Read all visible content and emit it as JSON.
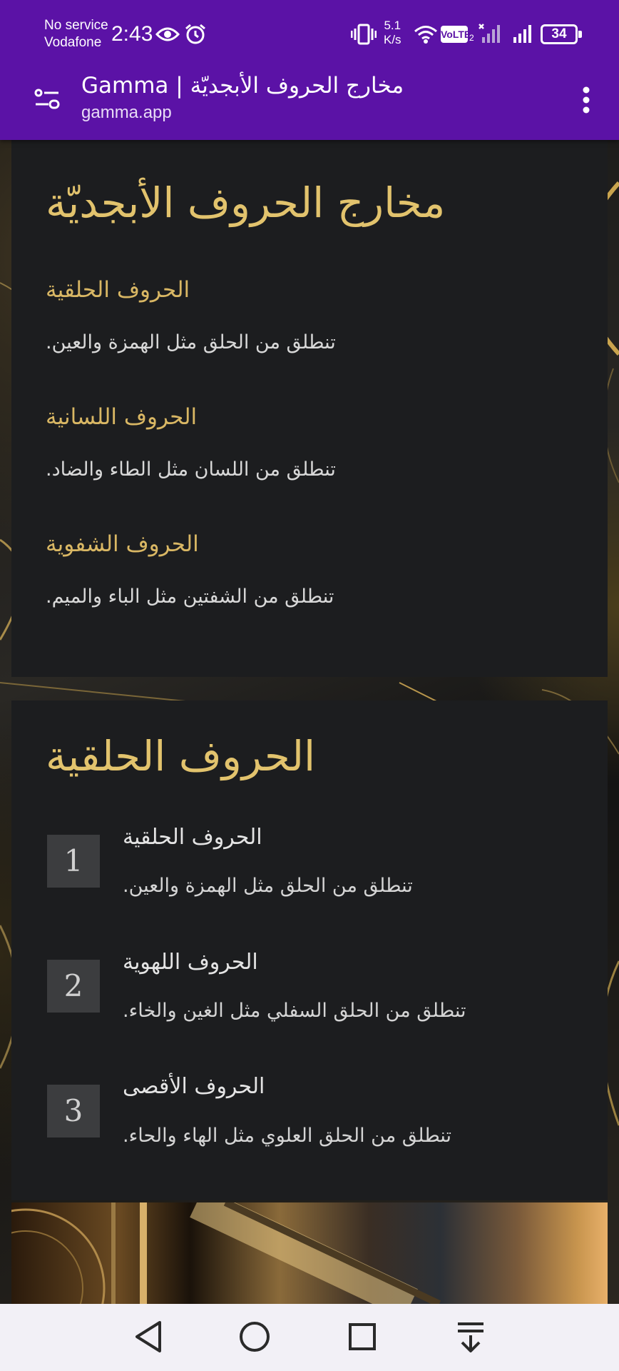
{
  "status_bar": {
    "carrier_line1": "No service",
    "carrier_line2": "Vodafone",
    "time": "2:43",
    "net_speed_value": "5.1",
    "net_speed_unit": "K/s",
    "volte_label": "VoLTE",
    "sim_slot": "2",
    "battery_level": "34",
    "icons": [
      "eye-icon",
      "alarm-icon",
      "vibrate-icon",
      "wifi-icon",
      "no-signal-icon",
      "signal-icon",
      "battery-icon"
    ]
  },
  "browser": {
    "page_title": "Gamma | مخارج الحروف الأبجديّة",
    "url": "gamma.app",
    "colors": {
      "toolbar": "#5b12a6"
    }
  },
  "card1": {
    "title": "مخارج الحروف الأبجديّة",
    "sections": [
      {
        "heading": "الحروف الحلقية",
        "text": "تنطلق من الحلق مثل الهمزة والعين."
      },
      {
        "heading": "الحروف اللسانية",
        "text": "تنطلق من اللسان مثل الطاء والضاد."
      },
      {
        "heading": "الحروف الشفوية",
        "text": "تنطلق من الشفتين مثل الباء والميم."
      }
    ]
  },
  "card2": {
    "title": "الحروف الحلقية",
    "steps": [
      {
        "number": "1",
        "title": "الحروف الحلقية",
        "text": "تنطلق من الحلق مثل الهمزة والعين."
      },
      {
        "number": "2",
        "title": "الحروف اللهوية",
        "text": "تنطلق من الحلق السفلي مثل الغين والخاء."
      },
      {
        "number": "3",
        "title": "الحروف الأقصى",
        "text": "تنطلق من الحلق العلوي مثل الهاء والحاء."
      }
    ]
  },
  "theme": {
    "accent_gold": "#e2c36d",
    "card_bg": "#1c1d1f",
    "number_box_bg": "#3c3d3f"
  },
  "nav_bar": {
    "buttons": [
      "back-icon",
      "home-icon",
      "recents-icon",
      "hide-nav-icon"
    ]
  }
}
